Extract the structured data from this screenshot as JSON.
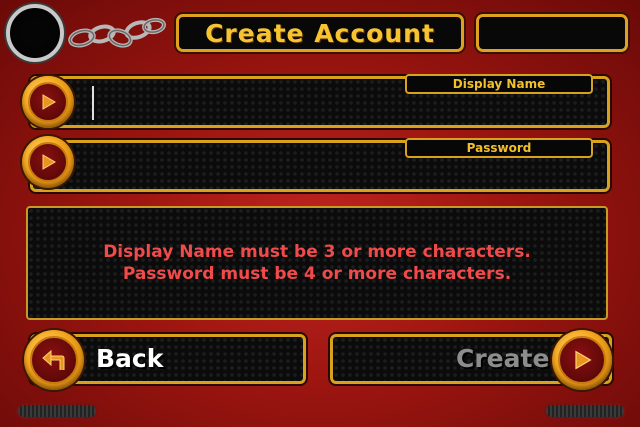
{
  "title": "Create Account",
  "fields": {
    "display_name": {
      "label": "Display Name",
      "value": ""
    },
    "password": {
      "label": "Password",
      "value": ""
    }
  },
  "messages": [
    "Display Name must be 3 or more characters.",
    "Password must be 4 or more characters."
  ],
  "buttons": {
    "back": "Back",
    "create": "Create"
  },
  "icons": {
    "field_arrow": "play-arrow-icon",
    "back": "return-arrow-icon",
    "create": "play-arrow-icon",
    "chain": "chain-icon"
  },
  "colors": {
    "accent": "#f7c431",
    "error": "#f14a4a",
    "background": "#9c1510"
  }
}
